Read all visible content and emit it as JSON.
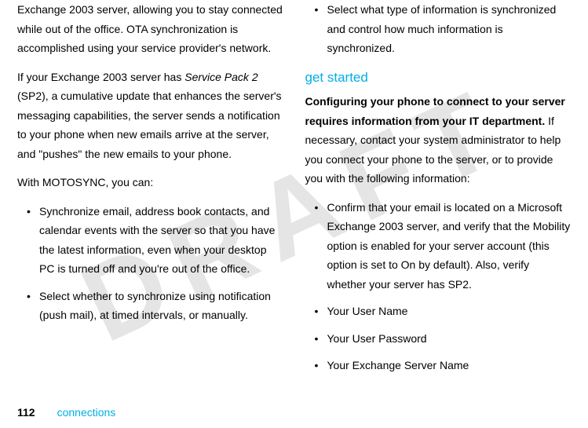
{
  "watermark": "DRAFT",
  "left": {
    "p1_a": "Exchange 2003 server, allowing you to stay connected while out of the office. OTA synchronization is accomplished using your service provider's network.",
    "p2_a": "If your Exchange 2003 server has ",
    "p2_italic": "Service Pack 2",
    "p2_b": " (SP2), a cumulative update that enhances the server's messaging capabilities, the server sends a notification to your phone when new emails arrive at the server, and \"pushes\" the new emails to your phone.",
    "p3": "With MOTOSYNC, you can:",
    "bullets": [
      "Synchronize email, address book contacts, and calendar events with the server so that you have the latest information, even when your desktop PC is turned off and you're out of the office.",
      "Select whether to synchronize using notification (push mail), at timed intervals, or manually."
    ]
  },
  "right": {
    "bullet_top": "Select what type of information is synchronized and control how much information is synchronized.",
    "heading": "get started",
    "p1_bold": "Configuring your phone to connect to your server requires information from your IT department.",
    "p1_rest": " If necessary, contact your system administrator to help you connect your phone to the server, or to provide you with the following information:",
    "bullets": [
      "Confirm that your email is located on a Microsoft Exchange 2003 server, and verify that the Mobility option is enabled for your server account (this option is set to On by default). Also, verify whether your server has SP2.",
      "Your User Name",
      "Your User Password",
      "Your Exchange Server Name"
    ]
  },
  "footer": {
    "page_num": "112",
    "label": "connections"
  }
}
